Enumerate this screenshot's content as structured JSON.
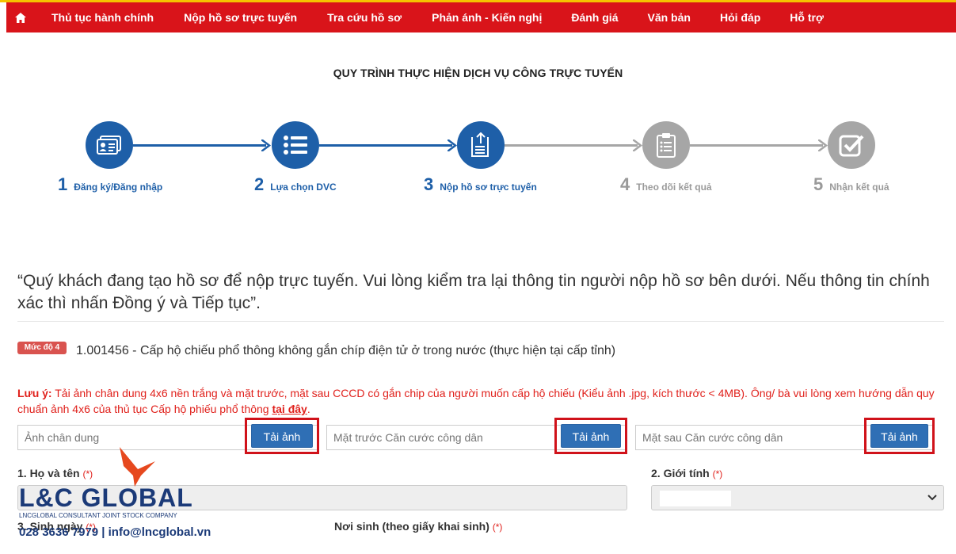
{
  "nav": {
    "home_icon": "home-icon",
    "items": [
      "Thủ tục hành chính",
      "Nộp hồ sơ trực tuyến",
      "Tra cứu hồ sơ",
      "Phản ánh - Kiến nghị",
      "Đánh giá",
      "Văn bản",
      "Hỏi đáp",
      "Hỗ trợ"
    ]
  },
  "process_title": "QUY TRÌNH THỰC HIỆN DỊCH VỤ CÔNG TRỰC TUYẾN",
  "steps": [
    {
      "num": "1",
      "label": "Đăng ký/Đăng nhập",
      "icon": "id-card-icon",
      "active": true
    },
    {
      "num": "2",
      "label": "Lựa chọn DVC",
      "icon": "list-icon",
      "active": true
    },
    {
      "num": "3",
      "label": "Nộp hồ sơ trực tuyến",
      "icon": "document-upload-icon",
      "active": true
    },
    {
      "num": "4",
      "label": "Theo dõi kết quả",
      "icon": "clipboard-icon",
      "active": false
    },
    {
      "num": "5",
      "label": "Nhận kết quả",
      "icon": "checkbox-icon",
      "active": false
    }
  ],
  "notice": "“Quý khách đang tạo hồ sơ để nộp trực tuyến. Vui lòng kiểm tra lại thông tin người nộp hồ sơ bên dưới. Nếu thông tin chính xác thì nhấn Đồng ý và Tiếp tục”.",
  "procedure": {
    "level_badge": "Mức độ 4",
    "name": "1.001456 - Cấp hộ chiếu phổ thông không gắn chíp điện tử ở trong nước (thực hiện tại cấp tỉnh)"
  },
  "note": {
    "prefix": "Lưu ý:",
    "text": " Tải ảnh chân dung 4x6 nền trắng và mặt trước, mặt sau CCCD có gắn chip của người muốn cấp hộ chiếu (Kiểu ảnh .jpg, kích thước < 4MB). Ông/ bà vui lòng xem hướng dẫn quy chuẩn ảnh 4x6 của thủ tục Cấp hộ phiếu phổ thông ",
    "link": "tại đây",
    "suffix": "."
  },
  "uploads": [
    {
      "placeholder": "Ảnh chân dung",
      "button": "Tải ảnh"
    },
    {
      "placeholder": "Mặt trước Căn cước công dân",
      "button": "Tải ảnh"
    },
    {
      "placeholder": "Mặt sau Căn cước công dân",
      "button": "Tải ảnh"
    }
  ],
  "form": {
    "full_name_label": "1. Họ và tên",
    "gender_label": "2. Giới tính",
    "dob_label": "3. Sinh ngày",
    "birthplace_label": "Nơi sinh (theo giấy khai sinh)",
    "required_mark": "(*)"
  },
  "watermark": {
    "brand": "L&C GLOBAL",
    "tagline": "LNCGLOBAL CONSULTANT JOINT STOCK COMPANY",
    "contact": "028 3636 7979 | info@lncglobal.vn"
  },
  "colors": {
    "nav_red": "#d9141a",
    "active_blue": "#1e5fa8",
    "inactive_grey": "#a6a6a6",
    "button_blue": "#2f6fb5",
    "highlight_red": "#d0121a"
  }
}
